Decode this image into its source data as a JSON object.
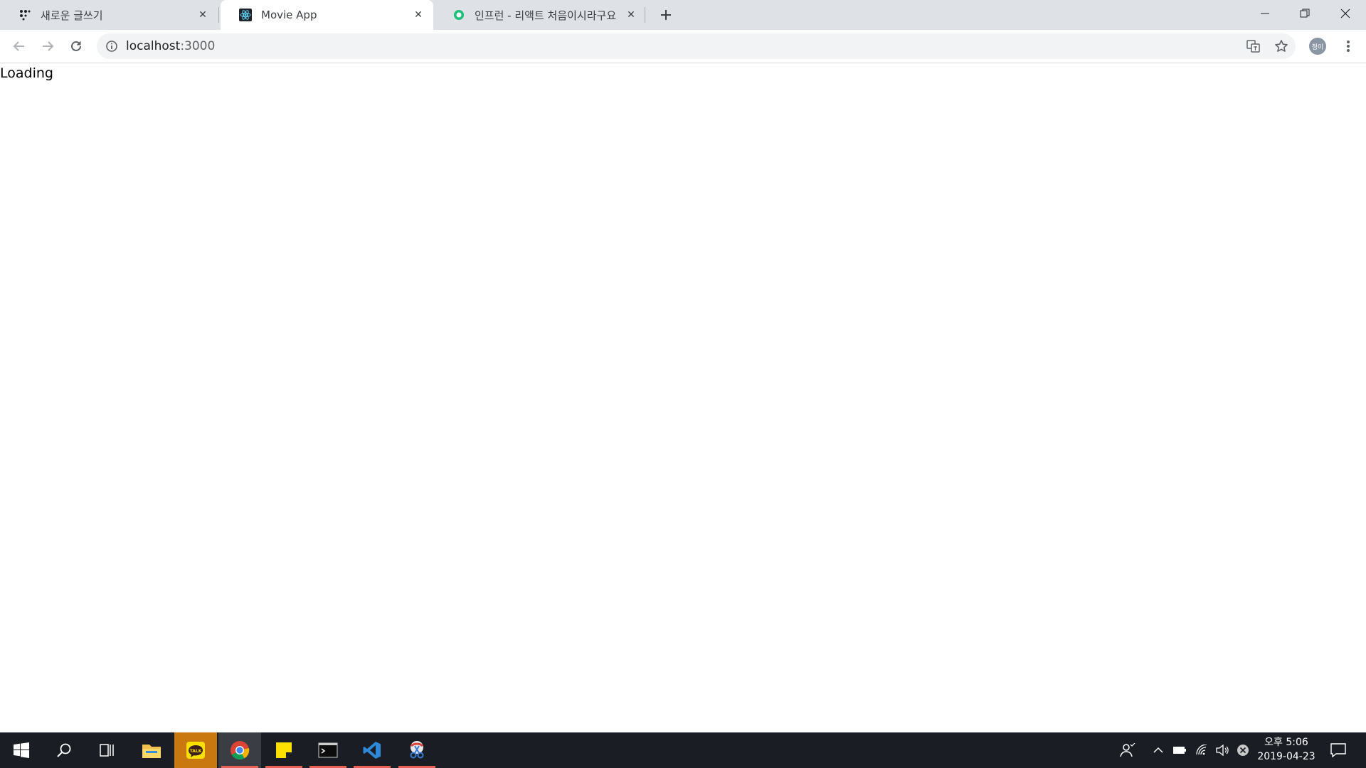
{
  "tabs": [
    {
      "label": "새로운 글쓰기",
      "icon": "dots-grid-icon"
    },
    {
      "label": "Movie App",
      "icon": "react-icon"
    },
    {
      "label": "인프런 - 리액트 처음이시라구요",
      "icon": "inflearn-icon"
    }
  ],
  "address": {
    "host": "localhost",
    "port": ":3000"
  },
  "page": {
    "loading_text": "Loading"
  },
  "profile": {
    "initials": "정이"
  },
  "clock": {
    "time": "오후 5:06",
    "date": "2019-04-23"
  },
  "colors": {
    "tabstrip": "#dee1e6",
    "taskbar": "#1a1d24",
    "accent_running": "#e96055"
  }
}
